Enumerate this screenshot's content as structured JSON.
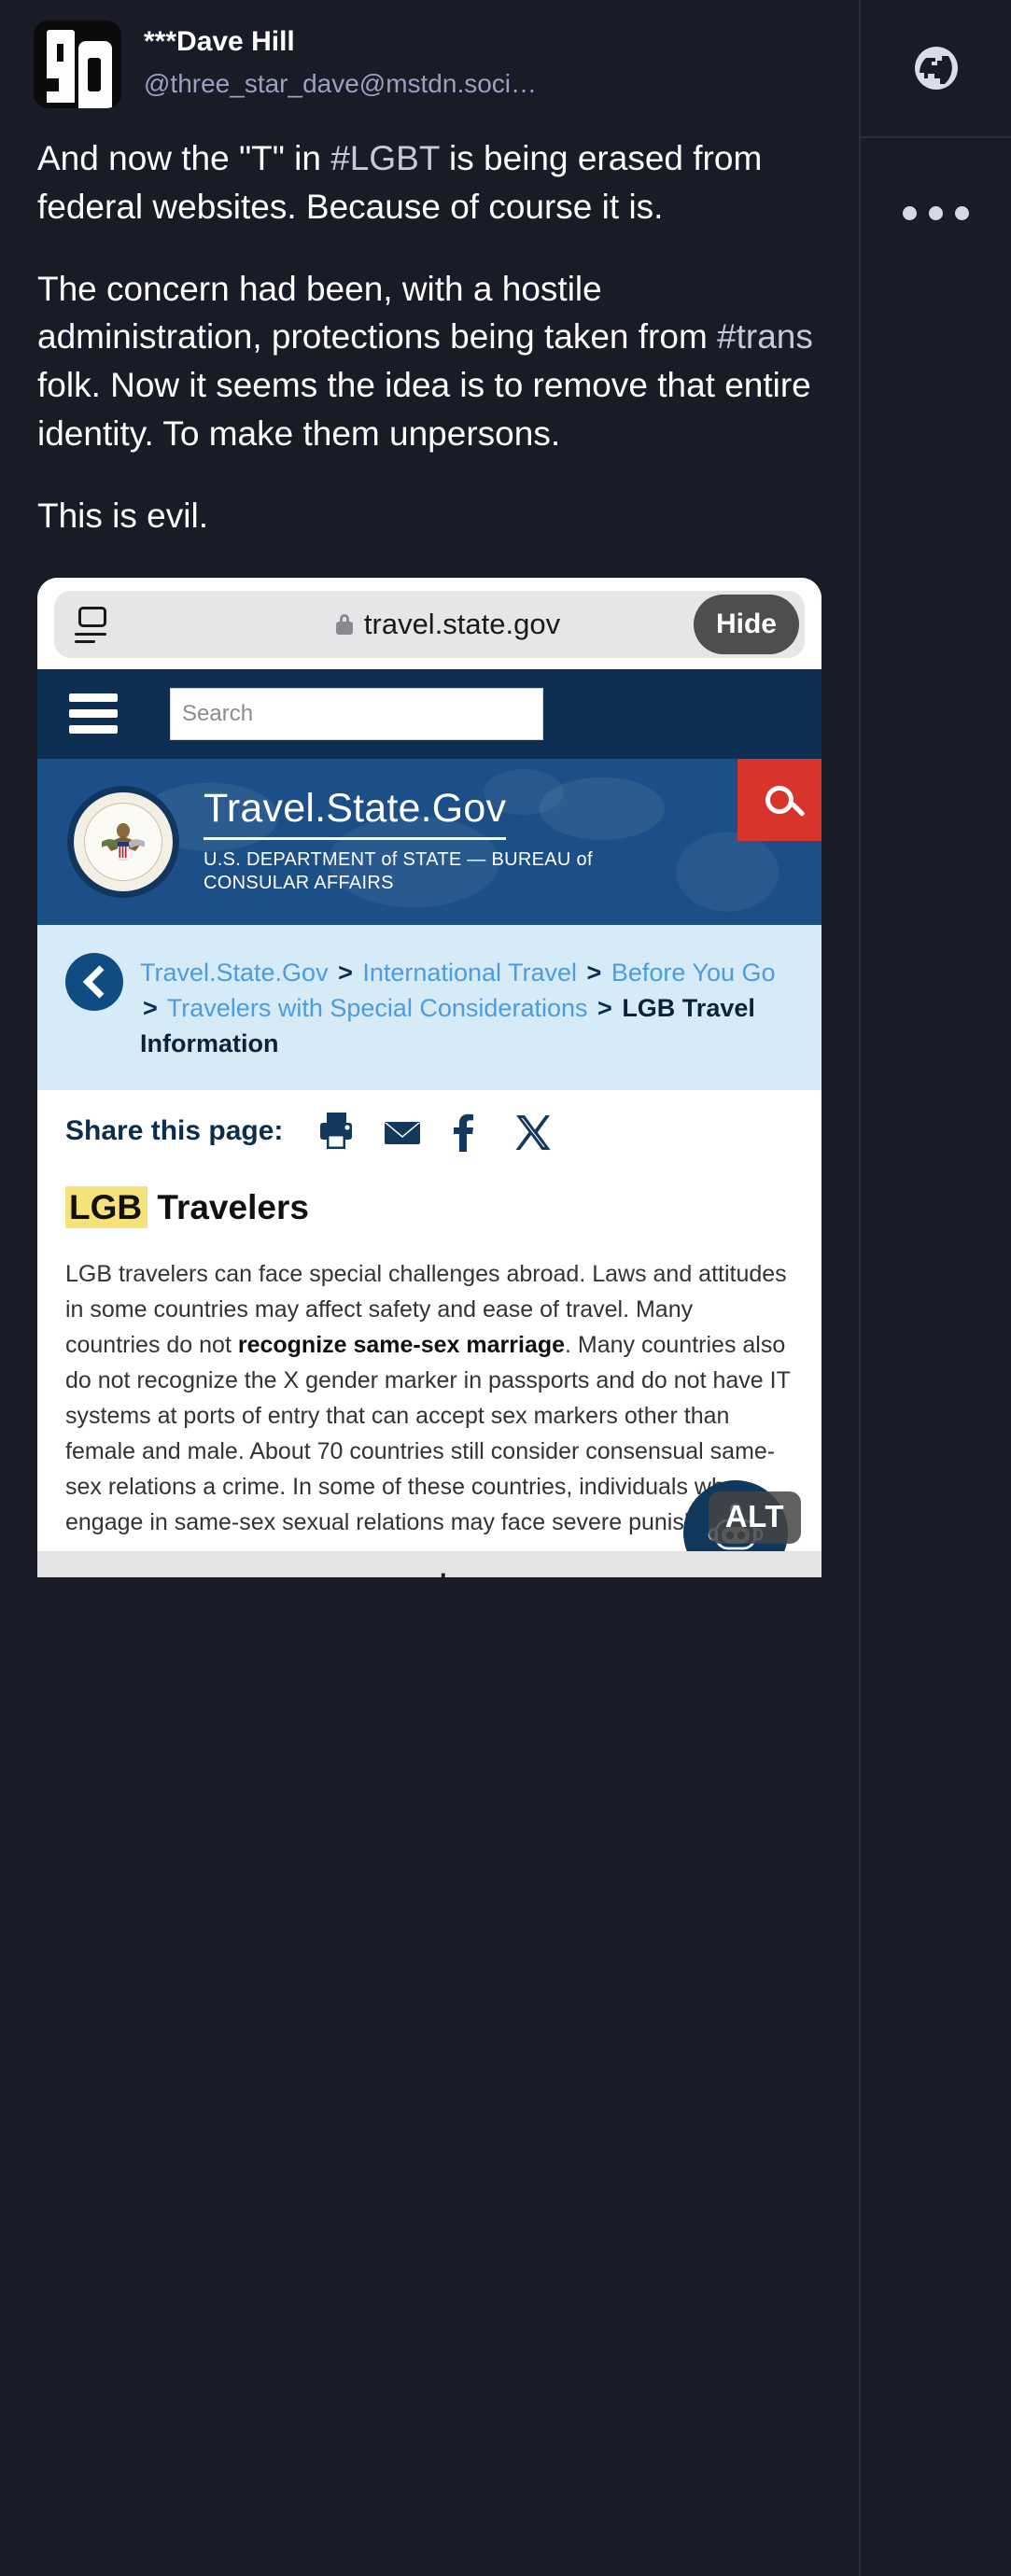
{
  "post": {
    "display_name": "***Dave Hill",
    "handle": "@three_star_dave@mstdn.soci…",
    "avatar_alt": "pixel-art-avatar",
    "paragraph_1_a": "And now the \"T\" in ",
    "paragraph_1_tag": "#LGBT",
    "paragraph_1_b": " is being erased from federal websites. Because of course it is.",
    "paragraph_2_a": "The concern had been, with a hostile administration, protections being taken from ",
    "paragraph_2_tag": "#trans",
    "paragraph_2_b": " folk. Now it seems the idea is to remove that entire identity. To make them unpersons.",
    "paragraph_3": "This is evil."
  },
  "sidebar": {
    "visibility_icon": "globe-icon",
    "more_icon": "ellipsis-icon"
  },
  "browser": {
    "reader_icon": "reader-view-icon",
    "lock_icon": "lock-icon",
    "url": "travel.state.gov",
    "hide_label": "Hide",
    "reload_icon": "reload-icon"
  },
  "gov_nav": {
    "menu_icon": "hamburger-menu-icon",
    "search_placeholder": "Search",
    "search_value": "",
    "search_submit_icon": "magnifier-icon"
  },
  "gov_header": {
    "seal_alt": "department-of-state-seal",
    "title": "Travel.State.Gov",
    "subtitle": "U.S. DEPARTMENT of STATE — BUREAU of CONSULAR AFFAIRS"
  },
  "breadcrumb": {
    "back_icon": "back-chevron-icon",
    "items": [
      {
        "label": "Travel.State.Gov",
        "current": false
      },
      {
        "label": "International Travel",
        "current": false
      },
      {
        "label": "Before You Go",
        "current": false
      },
      {
        "label": "Travelers with Special Considerations",
        "current": false
      },
      {
        "label": "LGB Travel Information",
        "current": true
      }
    ],
    "separator": ">"
  },
  "share": {
    "label": "Share this page:",
    "icons": [
      "print-icon",
      "email-icon",
      "facebook-icon",
      "x-twitter-icon"
    ]
  },
  "article": {
    "heading_highlight": "LGB",
    "heading_rest": " Travelers",
    "body_1": "LGB travelers can face special challenges abroad. Laws and attitudes in some countries may affect safety and ease of travel. Many countries do not ",
    "body_bold": "recognize same-sex marriage",
    "body_2": ". Many countries also do not recognize the X gender marker in passports and do not have IT systems at ports of entry that can accept sex markers other than female and male. About 70 countries still consider consensual same-sex relations a crime. In some of these countries, individuals who engage in same-sex sexual relations may face severe punishment."
  },
  "chatbot": {
    "icon": "robot-icon",
    "alt_badge": "ALT",
    "strip_label": "ALT 大/一"
  },
  "colors": {
    "page_bg": "#191b26",
    "gov_navy": "#0c2f52",
    "gov_blue": "#1c4f87",
    "gov_red": "#d9342b",
    "breadcrumb_bg": "#d6eaf8",
    "highlight_yellow": "#f6e27a",
    "link_blue": "#4a9de0"
  }
}
